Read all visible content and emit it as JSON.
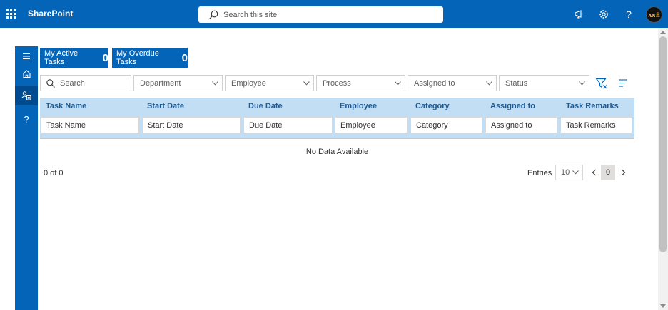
{
  "suite": {
    "brand": "SharePoint",
    "search_placeholder": "Search this site",
    "avatar_initials": "ᴀɴɦ"
  },
  "tabs": [
    {
      "label": "My Active Tasks",
      "count": "0"
    },
    {
      "label": "My Overdue Tasks",
      "count": "0"
    }
  ],
  "filters": {
    "search_placeholder": "Search",
    "dropdowns": [
      "Department",
      "Employee",
      "Process",
      "Assigned to",
      "Status"
    ]
  },
  "table": {
    "columns": [
      "Task Name",
      "Start Date",
      "Due Date",
      "Employee",
      "Category",
      "Assigned to",
      "Task Remarks"
    ],
    "filter_placeholders": [
      "Task Name",
      "Start Date",
      "Due Date",
      "Employee",
      "Category",
      "Assigned to",
      "Task Remarks"
    ],
    "empty_text": "No Data Available"
  },
  "pager": {
    "summary": "0 of 0",
    "entries_label": "Entries",
    "entries_value": "10",
    "current_page": "0"
  },
  "colors": {
    "suite_blue": "#0364b8",
    "header_blue": "#c2def4",
    "header_text": "#1d5a94"
  }
}
